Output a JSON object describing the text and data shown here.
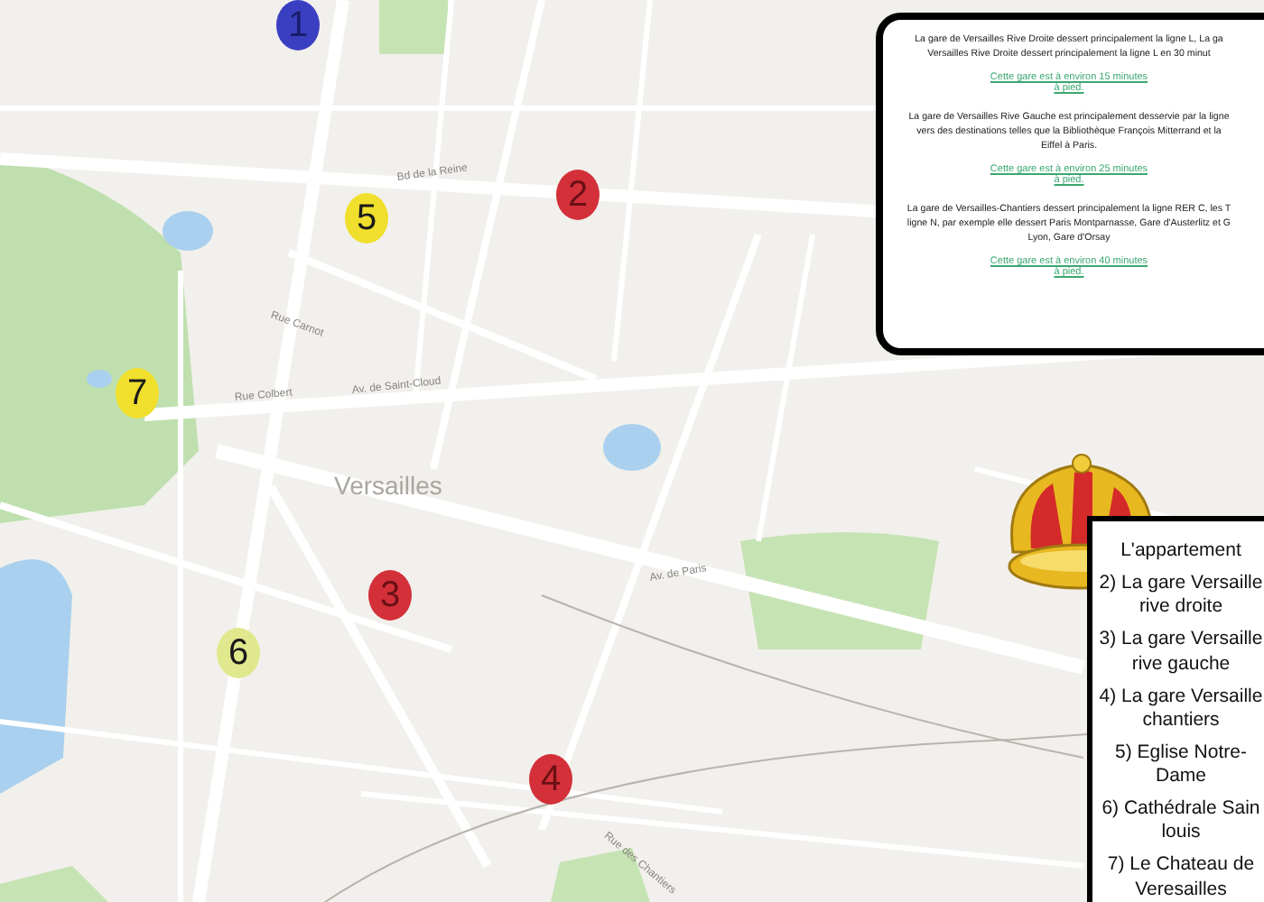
{
  "map": {
    "labels": [
      "Versailles",
      "Bd de la Reine",
      "Rue Carnot",
      "Av. de Saint-Cloud",
      "Rue Colbert",
      "Av. de Paris",
      "Rue des Chantiers"
    ]
  },
  "markers": [
    {
      "label": "1",
      "color": "#3a3fc2"
    },
    {
      "label": "2",
      "color": "#d3303a"
    },
    {
      "label": "3",
      "color": "#d3303a"
    },
    {
      "label": "4",
      "color": "#d3303a"
    },
    {
      "label": "5",
      "color": "#f0df2c"
    },
    {
      "label": "6",
      "color": "#e0e88e"
    },
    {
      "label": "7",
      "color": "#f0df2c"
    }
  ],
  "info_box": {
    "stations": [
      {
        "lines": [
          "La gare de Versailles Rive Droite dessert principalement la ligne L, La ga",
          "Versailles Rive Droite dessert principalement la ligne L  en 30 minut"
        ],
        "walk_link": "Cette gare est à environ 15 minutes à pied."
      },
      {
        "lines": [
          "La gare de Versailles Rive Gauche est principalement desservie par la ligne",
          "vers des destinations telles que la Bibliothèque François Mitterrand et la",
          "Eiffel à Paris."
        ],
        "walk_link": "Cette gare est à environ 25 minutes à pied."
      },
      {
        "lines": [
          "La gare de Versailles-Chantiers dessert principalement la ligne RER C, les T",
          "ligne N, par exemple elle dessert Paris Montparnasse, Gare d'Austerlitz et G",
          "Lyon, Gare d'Orsay"
        ],
        "walk_link": "Cette gare est à environ 40 minutes à pied."
      }
    ]
  },
  "legend": [
    [
      "L'appartement"
    ],
    [
      "2) La gare Versaille",
      "rive droite"
    ],
    [
      "3) La gare Versaille",
      "rive gauche"
    ],
    [
      "4) La gare Versaille",
      "chantiers"
    ],
    [
      "5) Eglise Notre-",
      "Dame"
    ],
    [
      "6) Cathédrale Sain",
      "louis"
    ],
    [
      "7) Le Chateau de",
      "Veresailles"
    ]
  ]
}
